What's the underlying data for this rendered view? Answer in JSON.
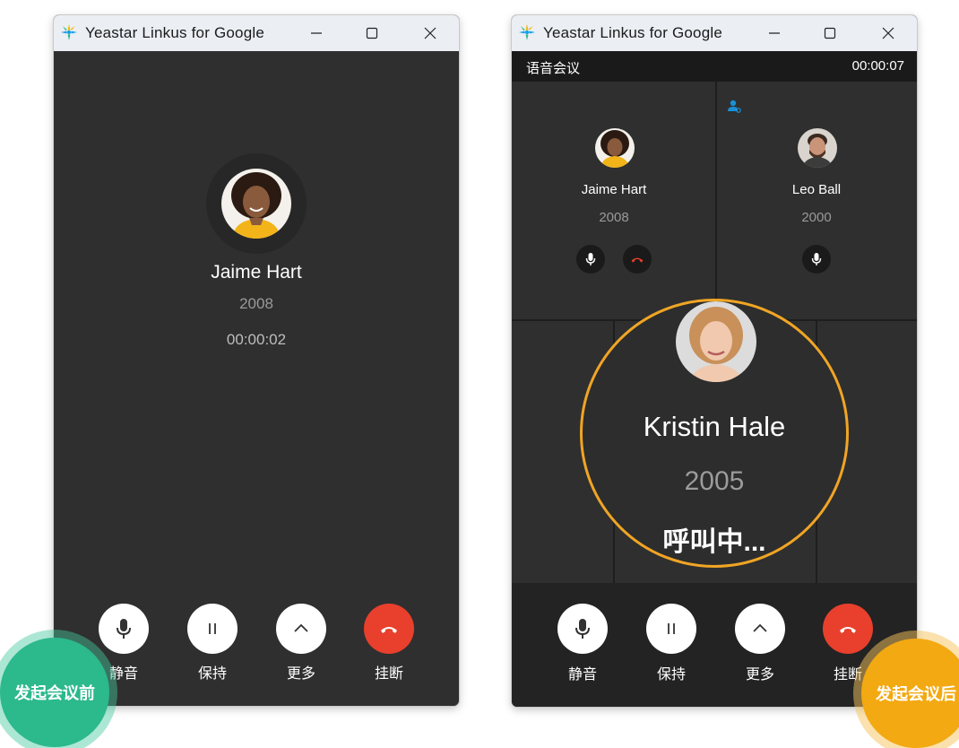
{
  "window_before": {
    "app_title": "Yeastar Linkus for Google",
    "caller": {
      "name": "Jaime Hart",
      "extension": "2008",
      "timer": "00:00:02"
    },
    "controls": [
      {
        "label": "静音",
        "icon": "microphone-icon"
      },
      {
        "label": "保持",
        "icon": "pause-icon"
      },
      {
        "label": "更多",
        "icon": "chevron-up-icon"
      },
      {
        "label": "挂断",
        "icon": "hangup-icon"
      }
    ]
  },
  "window_after": {
    "app_title": "Yeastar Linkus for Google",
    "conference": {
      "title": "语音会议",
      "timer": "00:00:07"
    },
    "participants": [
      {
        "name": "Jaime Hart",
        "extension": "2008"
      },
      {
        "name": "Leo Ball",
        "extension": "2000"
      }
    ],
    "calling": {
      "name": "Kristin Hale",
      "extension": "2005",
      "status": "呼叫中..."
    },
    "controls": [
      {
        "label": "静音",
        "icon": "microphone-icon"
      },
      {
        "label": "保持",
        "icon": "pause-icon"
      },
      {
        "label": "更多",
        "icon": "chevron-up-icon"
      },
      {
        "label": "挂断",
        "icon": "hangup-icon"
      }
    ]
  },
  "badges": {
    "before": "发起会议前",
    "after": "发起会议后"
  },
  "colors": {
    "accent_green": "#2cb98c",
    "accent_orange": "#f3a911",
    "hangup_red": "#e8402c",
    "zoom_ring": "#f0a524"
  }
}
